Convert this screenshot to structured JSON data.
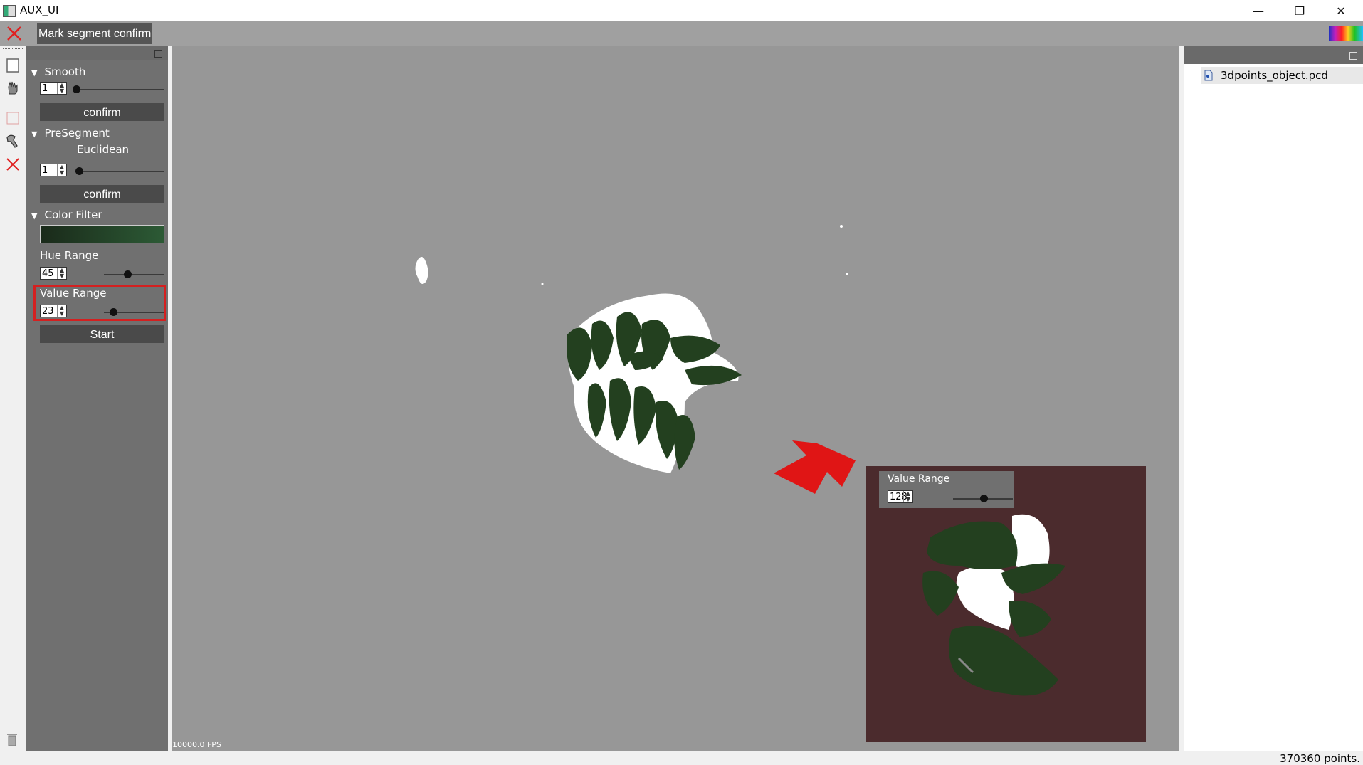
{
  "window": {
    "title": "AUX_UI",
    "minimize": "—",
    "restore": "❐",
    "close": "✕"
  },
  "toolbar": {
    "mark_segment_confirm": "Mark segment confirm"
  },
  "left_tools": [
    "select-rect-icon",
    "hand-icon",
    "box-select-icon",
    "eyedropper-icon",
    "delete-x-icon",
    "trash-icon"
  ],
  "panel": {
    "smooth": {
      "title": "Smooth",
      "value": "1",
      "confirm": "confirm"
    },
    "presegment": {
      "title": "PreSegment",
      "method": "Euclidean",
      "value": "1",
      "confirm": "confirm"
    },
    "color_filter": {
      "title": "Color Filter",
      "hue_label": "Hue Range",
      "hue_value": "45",
      "value_label": "Value Range",
      "value_value": "23",
      "start": "Start",
      "swatch_color": "#1e3d24"
    }
  },
  "viewer": {
    "fps": "10000.0 FPS",
    "background": "#979797",
    "leaf_color": "#23401f"
  },
  "inset": {
    "label": "Value Range",
    "value": "128",
    "background": "#4b2b2d"
  },
  "file_tree": {
    "items": [
      "3dpoints_object.pcd"
    ]
  },
  "status": {
    "points": "370360 points."
  },
  "colors": {
    "highlight": "#d42020",
    "arrow": "#e01515"
  }
}
